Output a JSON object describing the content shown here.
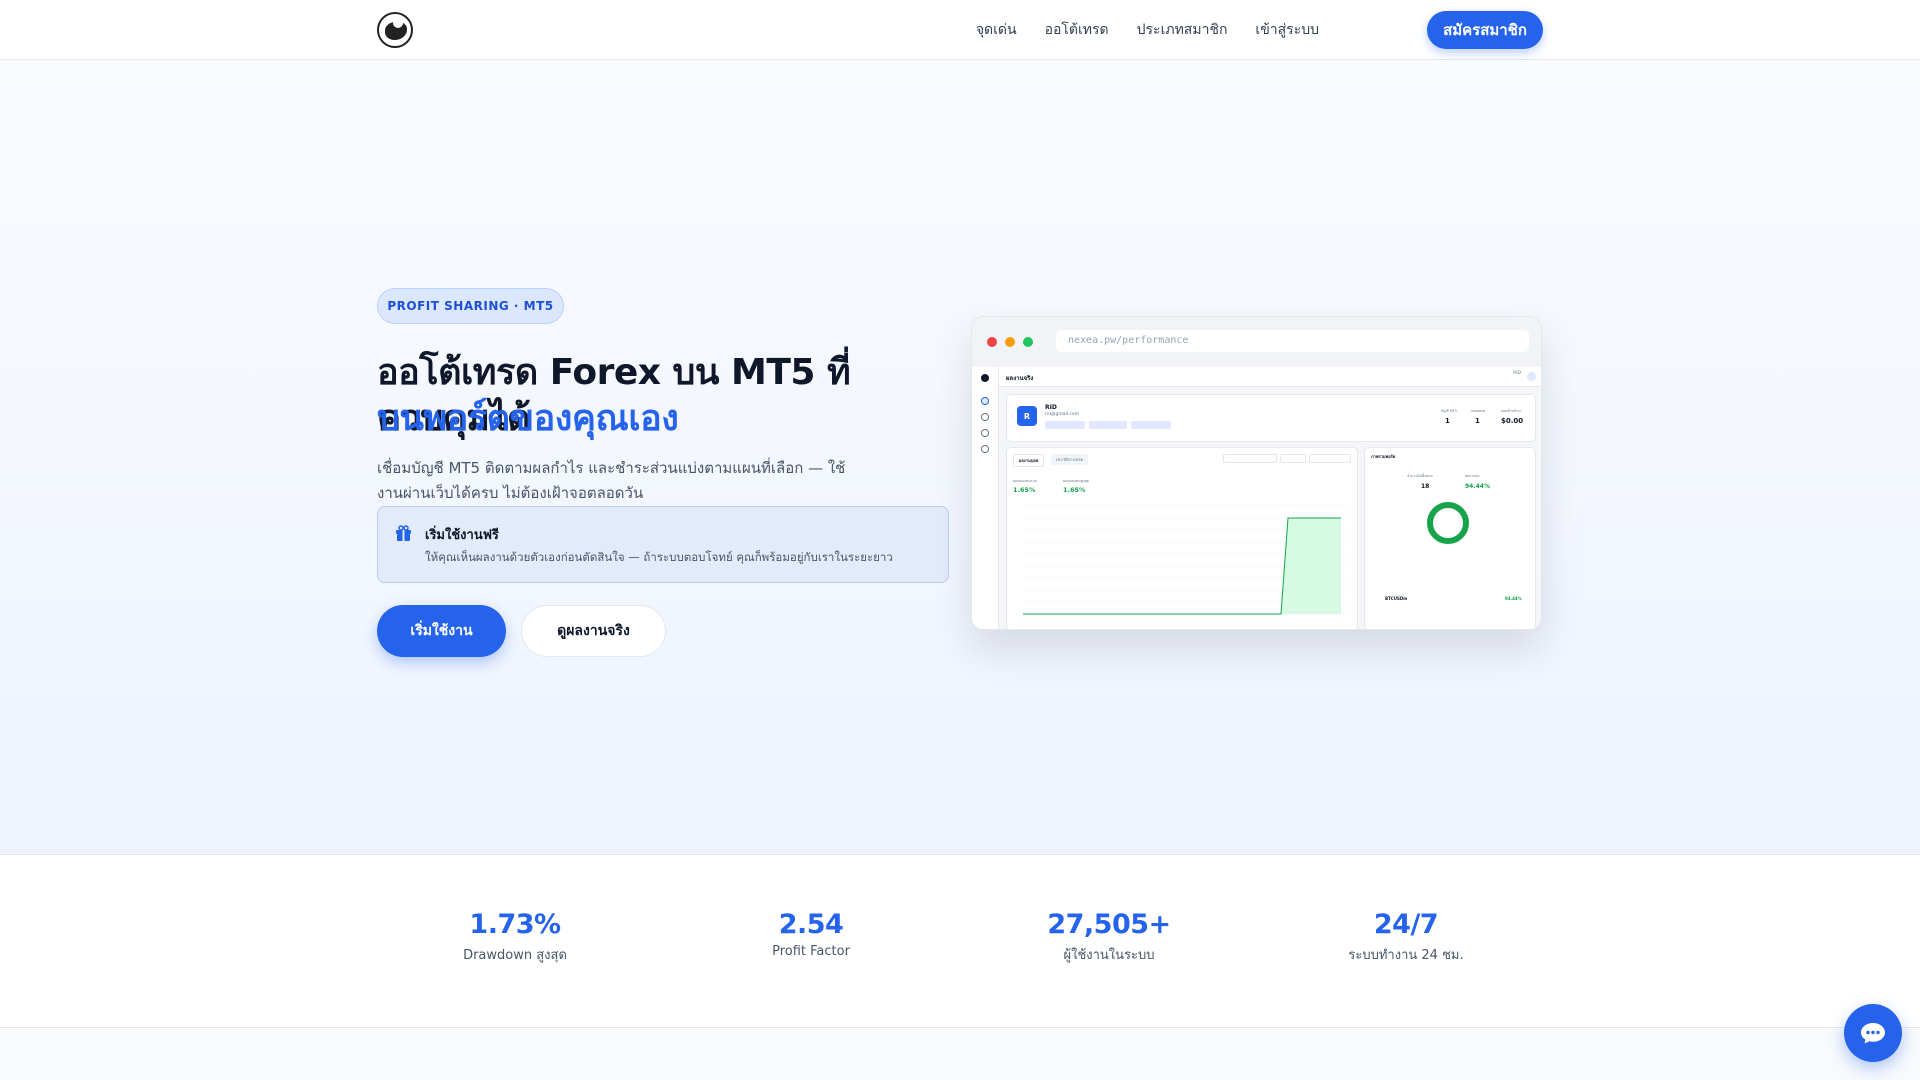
{
  "nav": {
    "links": [
      "จุดเด่น",
      "ออโต้เทรด",
      "ประเภทสมาชิก",
      "เข้าสู่ระบบ"
    ],
    "cta": "สมัครสมาชิก"
  },
  "hero": {
    "badge": "PROFIT SHARING · MT5",
    "title_line1": "ออโต้เทรด Forex บน MT5 ที่ควบคุมได้",
    "title_line2": "บนพอร์ตของคุณเอง",
    "subtitle": "เชื่อมบัญชี MT5 ติดตามผลกำไร และชำระส่วนแบ่งตามแผนที่เลือก — ใช้งานผ่านเว็บได้ครบ ไม่ต้องเฝ้าจอตลอดวัน",
    "promo": {
      "title": "เริ่มใช้งานฟรี",
      "text": "ให้คุณเห็นผลงานด้วยตัวเองก่อนตัดสินใจ — ถ้าระบบตอบโจทย์ คุณก็พร้อมอยู่กับเราในระยะยาว"
    },
    "primary_button": "เริ่มใช้งาน",
    "secondary_button": "ดูผลงานจริง"
  },
  "mockup": {
    "url": "nexea.pw/performance",
    "page_title": "ผลงานจริง",
    "account_initial": "R",
    "account_name": "RID",
    "account_email": "rid@gmail.com",
    "stats": [
      {
        "label": "บัญชี MT5",
        "value": "1"
      },
      {
        "label": "บอทเทรด",
        "value": "1"
      },
      {
        "label": "ยอดค้างชำระ",
        "value": "$0.00"
      }
    ],
    "tab_active": "ผลงานบอท",
    "tab_other": "ประวัติการเทรด",
    "kpis": [
      {
        "label": "ผลตอบแทนรวม",
        "value": "1.65%"
      },
      {
        "label": "ผลตอบแทนสูงสุด",
        "value": "1.65%"
      }
    ],
    "side_title": "ภาพรวมพอร์ต",
    "side_stats": [
      {
        "label": "จำนวนไม้ทั้งหมด",
        "value": "18"
      },
      {
        "label": "อัตราชนะ",
        "value": "94.44%"
      }
    ],
    "pair": "BTCUSDm",
    "pair_pct": "94.44%"
  },
  "stats": [
    {
      "value": "1.73%",
      "label": "Drawdown สูงสุด"
    },
    {
      "value": "2.54",
      "label": "Profit Factor"
    },
    {
      "value": "27,505+",
      "label": "ผู้ใช้งานในระบบ"
    },
    {
      "value": "24/7",
      "label": "ระบบทำงาน 24 ชม."
    }
  ],
  "colors": {
    "accent": "#2563eb",
    "profit": "#16a34a"
  }
}
